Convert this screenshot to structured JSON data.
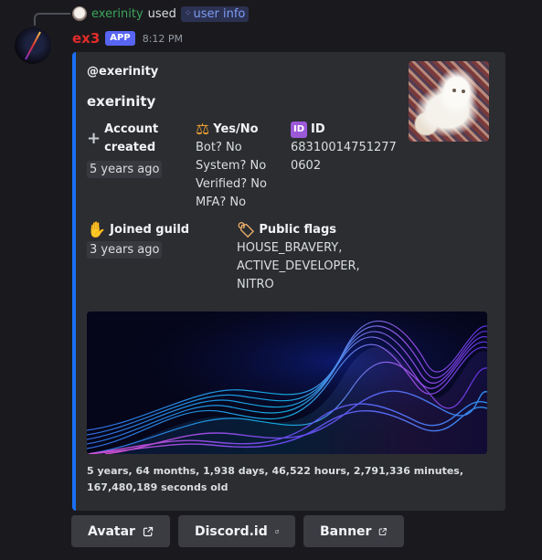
{
  "command_line": {
    "user": "exerinity",
    "used": "used",
    "command": "user info"
  },
  "message": {
    "author": "ex3",
    "badge": "APP",
    "time": "8:12 PM"
  },
  "embed": {
    "author_handle": "@exerinity",
    "title": "exerinity",
    "accent_color": "#1a6ff2",
    "fields": {
      "account_created": {
        "name": "Account created",
        "value": "5 years ago",
        "icon": "heavy-plus-icon"
      },
      "yes_no": {
        "name": "Yes/No",
        "icon": "balance-scale-icon",
        "lines": [
          "Bot? No",
          "System? No",
          "Verified? No",
          "MFA? No"
        ]
      },
      "id": {
        "name": "ID",
        "icon": "id-badge-icon",
        "icon_text": "ID",
        "lines": [
          "68310014751277",
          "0602"
        ]
      },
      "joined_guild": {
        "name": "Joined guild",
        "value": "3 years ago",
        "icon": "waving-hand-icon"
      },
      "public_flags": {
        "name": "Public flags",
        "icon": "label-tag-icon",
        "lines": [
          "HOUSE_BRAVERY,",
          "ACTIVE_DEVELOPER,",
          "NITRO"
        ]
      }
    },
    "footer": "5 years, 64 months, 1,938 days, 46,522 hours, 2,791,336 minutes, 167,480,189 seconds old"
  },
  "buttons": [
    {
      "label": "Avatar",
      "icon": "external-link-icon"
    },
    {
      "label": "Discord.id",
      "icon": "external-link-icon"
    },
    {
      "label": "Banner",
      "icon": "external-link-icon"
    }
  ]
}
